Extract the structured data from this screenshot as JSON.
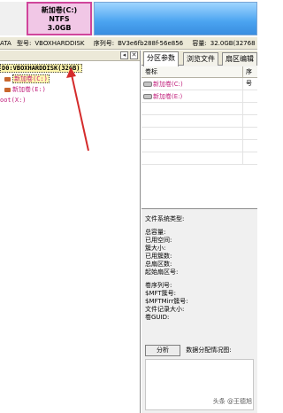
{
  "diskmap": {
    "partition_c": {
      "name": "新加卷(C:)",
      "fs": "NTFS",
      "size": "3.0GB"
    }
  },
  "infoline": {
    "interface_fragment": "ATA",
    "model_label": "型号:",
    "model_value": "VBOXHARDDISK",
    "serial_label": "序列号:",
    "serial_value": "BV3e6fb288f-56e856",
    "capacity_label": "容量:",
    "capacity_value": "32.0GB(32768"
  },
  "tree": {
    "root": "D0:VBOXHARDDISK(32GB)",
    "items": [
      "新加卷(C:)",
      "新加卷(E:)"
    ],
    "extra": "oot(X:)"
  },
  "right": {
    "tabs": [
      "分区参数",
      "浏览文件",
      "扇区编辑"
    ],
    "table": {
      "headers": [
        "卷标",
        "序号"
      ],
      "rows": [
        "新加卷(C:)",
        "新加卷(E:)"
      ]
    },
    "details": {
      "fs_type": "文件系统类型:",
      "group1": [
        "总容量:",
        "已用空间:",
        "簇大小:",
        "已用簇数:",
        "总扇区数:",
        "起始扇区号:"
      ],
      "group2": [
        "卷序列号:",
        "$MFT簇号:",
        "$MFTMirr簇号:",
        "文件记录大小:",
        "卷GUID:"
      ],
      "analyze_button": "分析",
      "analyze_chart_label": "数据分配情况图:"
    }
  },
  "watermark": "头条 @王德旭",
  "colors": {
    "partition_c_fill": "#f1c7e6",
    "partition_c_border": "#d0459b",
    "partition_e_fill": "#4aa3f0",
    "arrow": "#d42b2b"
  }
}
